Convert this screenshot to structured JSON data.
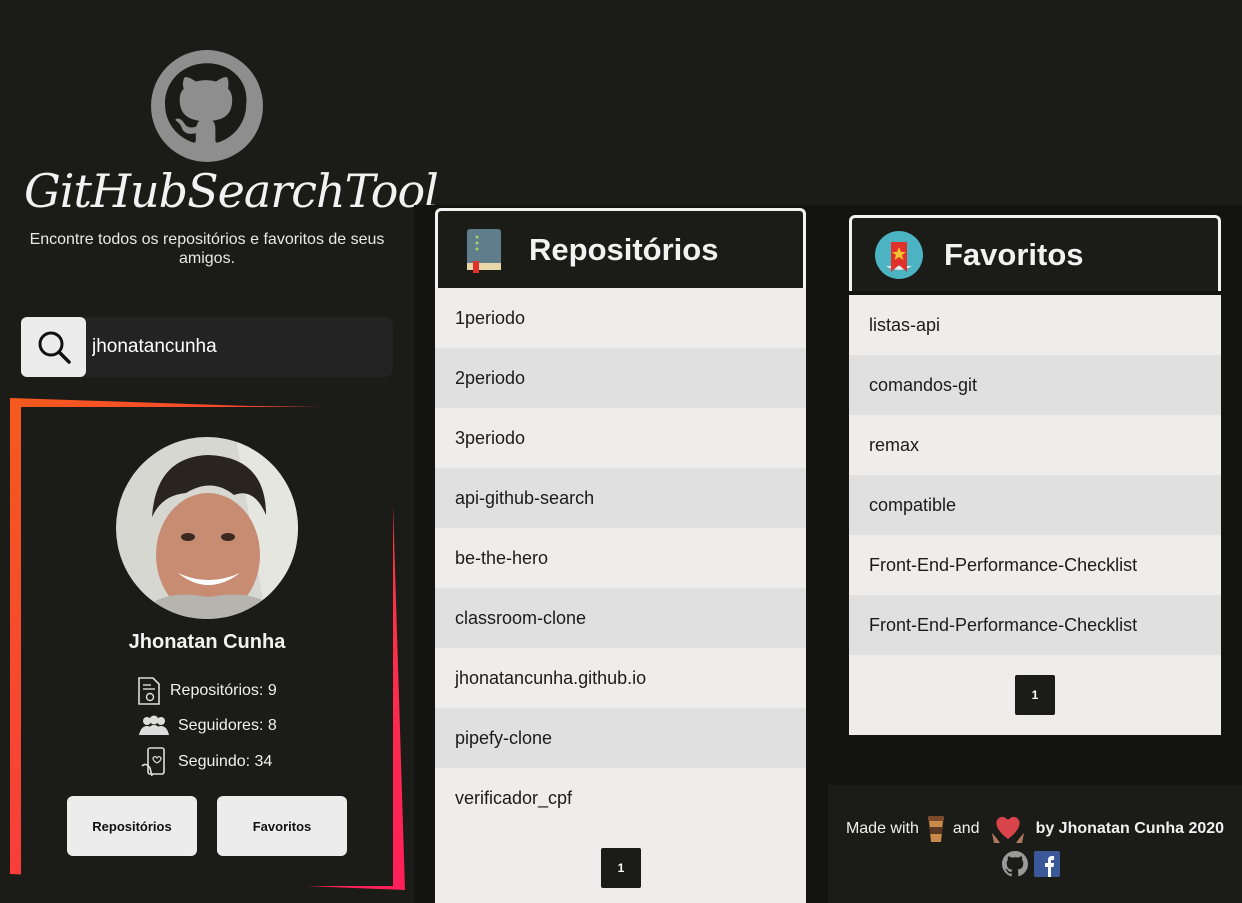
{
  "brand": {
    "name": "GitHubSearchTool",
    "tagline": "Encontre todos os repositórios e favoritos de seus amigos."
  },
  "search": {
    "value": "jhonatancunha",
    "placeholder": ""
  },
  "profile": {
    "name": "Jhonatan Cunha",
    "stats": {
      "repos": "Repositórios: 9",
      "followers": "Seguidores: 8",
      "following": "Seguindo: 34"
    },
    "buttons": {
      "repos": "Repositórios",
      "favorites": "Favoritos"
    }
  },
  "repositories": {
    "title": "Repositórios",
    "items": [
      "1periodo",
      "2periodo",
      "3periodo",
      "api-github-search",
      "be-the-hero",
      "classroom-clone",
      "jhonatancunha.github.io",
      "pipefy-clone",
      "verificador_cpf"
    ],
    "page": "1"
  },
  "favorites": {
    "title": "Favoritos",
    "items": [
      "listas-api",
      "comandos-git",
      "remax",
      "compatible",
      "Front-End-Performance-Checklist",
      "Front-End-Performance-Checklist"
    ],
    "page": "1"
  },
  "footer": {
    "made_with": "Made with",
    "and": "and",
    "by": "by Jhonatan Cunha 2020"
  },
  "colors": {
    "background": "#1b1b18",
    "panel": "#131311",
    "accent_gradient_start": "#f45a1c",
    "accent_gradient_end": "#ff1f5a",
    "list_light": "#eeedeb",
    "list_dark": "#e0e0e0"
  },
  "icons": [
    "github-icon",
    "search-icon",
    "document-icon",
    "users-icon",
    "phone-icon",
    "book-icon",
    "bookmark-icon",
    "coffee-icon",
    "heart-hands-icon",
    "facebook-icon"
  ]
}
